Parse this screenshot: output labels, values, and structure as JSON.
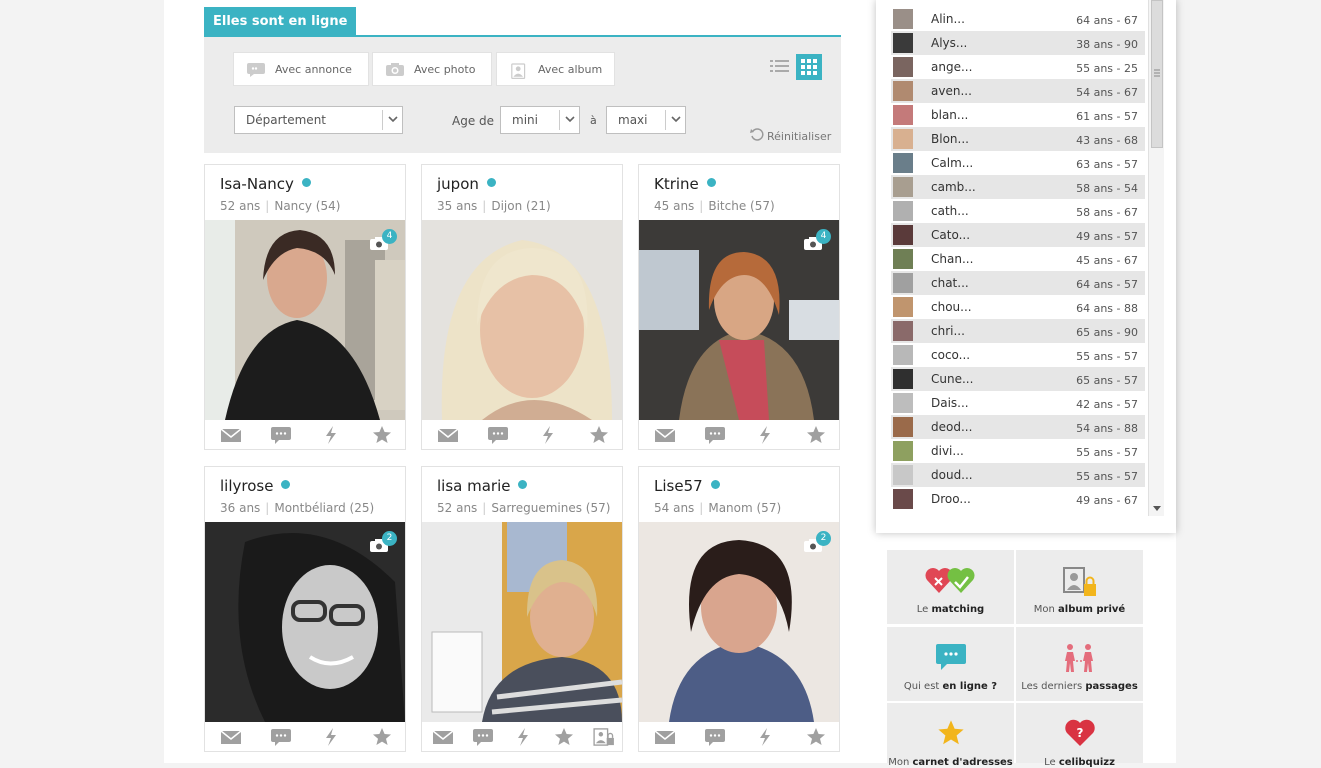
{
  "tab_title": "Elles sont en ligne",
  "filters": {
    "with_ad": "Avec annonce",
    "with_photo": "Avec photo",
    "with_album": "Avec album",
    "department": "Département",
    "age_from": "Age de",
    "age_min": "mini",
    "age_to": "à",
    "age_max": "maxi",
    "reset": "Réinitialiser"
  },
  "profiles": [
    {
      "name": "Isa-Nancy",
      "age": "52 ans",
      "city": "Nancy (54)",
      "photos": "4"
    },
    {
      "name": "jupon",
      "age": "35 ans",
      "city": "Dijon (21)",
      "photos": ""
    },
    {
      "name": "Ktrine",
      "age": "45 ans",
      "city": "Bitche (57)",
      "photos": "4"
    },
    {
      "name": "lilyrose",
      "age": "36 ans",
      "city": "Montbéliard (25)",
      "photos": "2"
    },
    {
      "name": "lisa marie",
      "age": "52 ans",
      "city": "Sarreguemines (57)",
      "photos": ""
    },
    {
      "name": "Lise57",
      "age": "54 ans",
      "city": "Manom (57)",
      "photos": "2"
    }
  ],
  "online_list": [
    {
      "name": "Alin...",
      "info": "64 ans - 67"
    },
    {
      "name": "Alys...",
      "info": "38 ans - 90"
    },
    {
      "name": "ange...",
      "info": "55 ans - 25"
    },
    {
      "name": "aven...",
      "info": "54 ans - 67"
    },
    {
      "name": "blan...",
      "info": "61 ans - 57"
    },
    {
      "name": "Blon...",
      "info": "43 ans - 68"
    },
    {
      "name": "Calm...",
      "info": "63 ans - 57"
    },
    {
      "name": "camb...",
      "info": "58 ans - 54"
    },
    {
      "name": "cath...",
      "info": "58 ans - 67"
    },
    {
      "name": "Cato...",
      "info": "49 ans - 57"
    },
    {
      "name": "Chan...",
      "info": "45 ans - 67"
    },
    {
      "name": "chat...",
      "info": "64 ans - 57"
    },
    {
      "name": "chou...",
      "info": "64 ans - 88"
    },
    {
      "name": "chri...",
      "info": "65 ans - 90"
    },
    {
      "name": "coco...",
      "info": "55 ans - 57"
    },
    {
      "name": "Cune...",
      "info": "65 ans - 57"
    },
    {
      "name": "Dais...",
      "info": "42 ans - 57"
    },
    {
      "name": "deod...",
      "info": "54 ans - 88"
    },
    {
      "name": "divi...",
      "info": "55 ans - 57"
    },
    {
      "name": "doud...",
      "info": "55 ans - 57"
    },
    {
      "name": "Droo...",
      "info": "49 ans - 67"
    }
  ],
  "tiles": [
    {
      "pre": "Le ",
      "bold": "matching"
    },
    {
      "pre": "Mon ",
      "bold": "album privé"
    },
    {
      "pre": "Qui est ",
      "bold": "en ligne ?"
    },
    {
      "pre": "Les derniers ",
      "bold": "passages"
    },
    {
      "pre": "Mon ",
      "bold": "carnet d'adresses"
    },
    {
      "pre": "Le ",
      "bold": "celibquizz"
    }
  ],
  "colors": {
    "accent": "#3bb3c3",
    "icon_gray": "#9a9a9a"
  }
}
